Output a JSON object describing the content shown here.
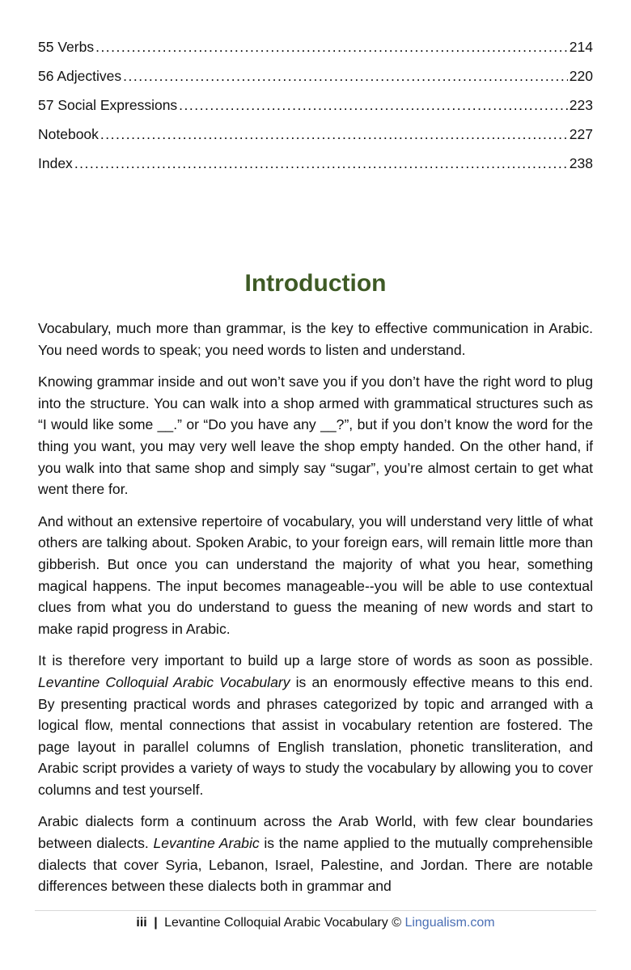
{
  "toc": [
    {
      "title": "55 Verbs",
      "page": "214"
    },
    {
      "title": "56 Adjectives",
      "page": "220"
    },
    {
      "title": "57 Social Expressions",
      "page": "223"
    },
    {
      "title": "Notebook",
      "page": "227"
    },
    {
      "title": "Index",
      "page": "238"
    }
  ],
  "heading": "Introduction",
  "colors": {
    "heading": "#3e5a25",
    "link": "#4a6fb5"
  },
  "paragraphs": {
    "p1": "Vocabulary, much more than grammar, is the key to effective communication in Arabic. You need words to speak; you need words to listen and understand.",
    "p2": "Knowing grammar inside and out won’t save you if you don’t have the right word to plug into the structure. You can walk into a shop armed with grammatical structures such as “I would like some __.” or “Do you have any __?”, but if you don’t know the word for the thing you want, you may very well leave the shop empty handed. On the other hand, if you walk into that same shop and simply say “sugar”, you’re almost certain to get what went there for.",
    "p3": "And without an extensive repertoire of vocabulary, you will understand very little of what others are talking about. Spoken Arabic, to your foreign ears, will remain little more than gibberish. But once you can understand the majority of what you hear, something magical happens. The input becomes manageable--you will be able to use contextual clues from what you do understand to guess the meaning of new words and start to make rapid progress in Arabic.",
    "p4_a": "It is therefore very important to build up a large store of words as soon as possible. ",
    "p4_em": "Levantine Colloquial Arabic Vocabulary",
    "p4_b": " is an enormously effective means to this end. By presenting practical words and phrases categorized by topic and arranged with a logical flow, mental connections that assist in vocabulary retention are fostered. The page layout in parallel columns of English translation, phonetic transliteration, and Arabic script provides a variety of ways to study the vocabulary by allowing you to cover columns and test yourself.",
    "p5_a": "Arabic dialects form a continuum across the Arab World, with few clear boundaries between dialects. ",
    "p5_em": "Levantine Arabic",
    "p5_b": " is the name applied to the mutually comprehensible dialects that cover Syria, Lebanon, Israel, Palestine, and Jordan. There are notable differences between these dialects both in grammar and"
  },
  "footer": {
    "page_number": "iii",
    "separator": "|",
    "text": "Levantine Colloquial Arabic Vocabulary ©",
    "link": "Lingualism.com"
  }
}
